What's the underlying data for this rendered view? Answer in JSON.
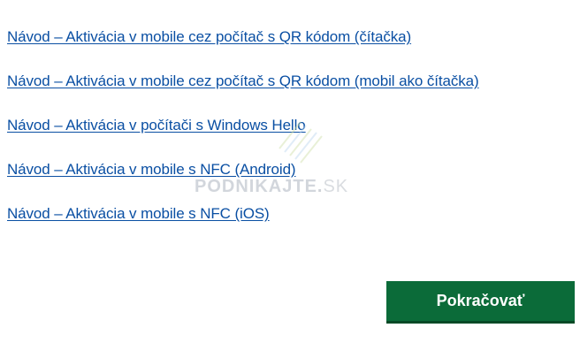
{
  "links": [
    {
      "label": "Návod – Aktivácia v mobile cez počítač s QR kódom (čítačka)"
    },
    {
      "label": "Návod – Aktivácia v mobile cez počítač s QR kódom (mobil ako čítačka)"
    },
    {
      "label": "Návod – Aktivácia v počítači s Windows Hello"
    },
    {
      "label": "Návod – Aktivácia v mobile s NFC (Android)"
    },
    {
      "label": "Návod – Aktivácia v mobile s NFC (iOS)"
    }
  ],
  "watermark": {
    "brand": "PODNIKAJTE",
    "dot": ".",
    "tld": "SK"
  },
  "continue_button": {
    "label": "Pokračovať"
  },
  "colors": {
    "link": "#0a4fa3",
    "button_bg": "#0b6b39",
    "button_text": "#ffffff"
  }
}
